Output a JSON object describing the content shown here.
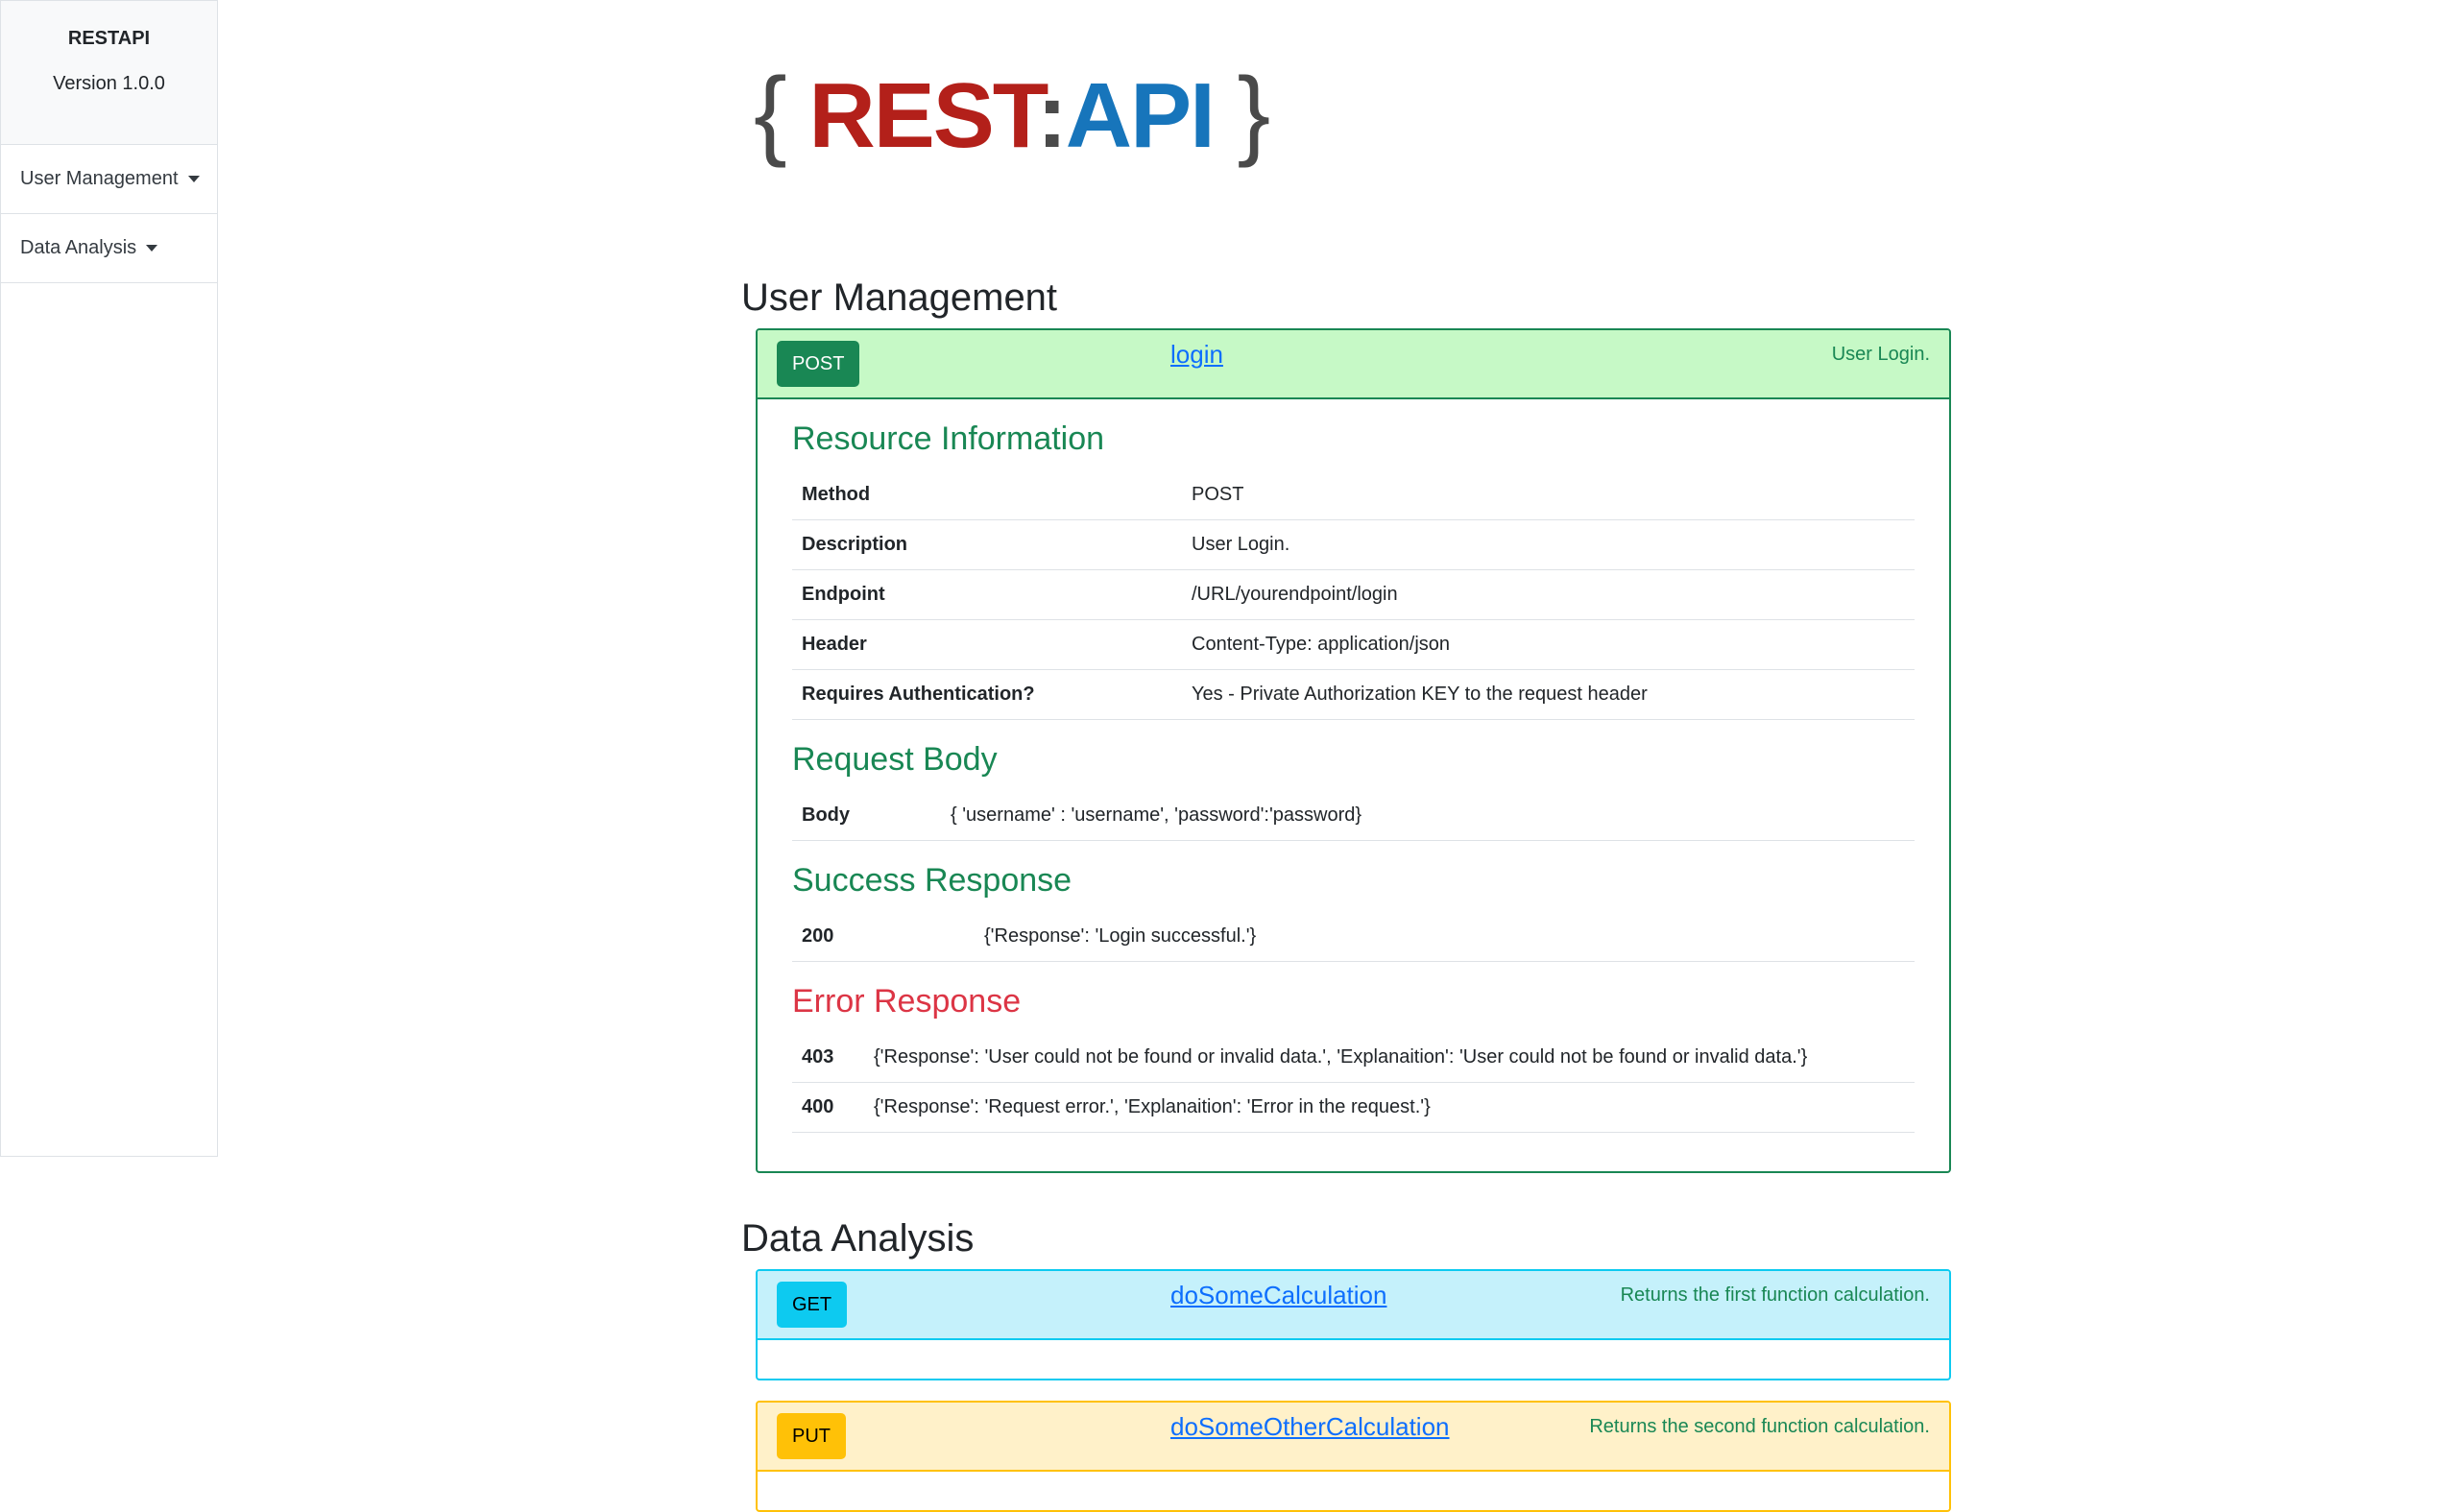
{
  "sidebar": {
    "title": "RESTAPI",
    "version": "Version 1.0.0",
    "items": [
      {
        "label": "User Management"
      },
      {
        "label": "Data Analysis"
      }
    ]
  },
  "logo": {
    "open_brace": "{",
    "rest": "REST",
    "colon": ":",
    "api": "API",
    "close_brace": "}"
  },
  "sections": {
    "user_management": {
      "title": "User Management",
      "login": {
        "method": "POST",
        "name": "login",
        "summary": "User Login.",
        "resource_title": "Resource Information",
        "resource_rows": [
          {
            "key": "Method",
            "value": "POST"
          },
          {
            "key": "Description",
            "value": "User Login."
          },
          {
            "key": "Endpoint",
            "value": "/URL/yourendpoint/login"
          },
          {
            "key": "Header",
            "value": "Content-Type: application/json"
          },
          {
            "key": "Requires Authentication?",
            "value": "Yes - Private Authorization KEY to the request header"
          }
        ],
        "request_title": "Request Body",
        "request_rows": [
          {
            "key": "Body",
            "value": "{ 'username' : 'username', 'password':'password}"
          }
        ],
        "success_title": "Success Response",
        "success_rows": [
          {
            "key": "200",
            "value": "{'Response': 'Login successful.'}"
          }
        ],
        "error_title": "Error Response",
        "error_rows": [
          {
            "key": "403",
            "value": "{'Response': 'User could not be found or invalid data.', 'Explanaition': 'User could not be found or invalid data.'}"
          },
          {
            "key": "400",
            "value": "{'Response': 'Request error.', 'Explanaition': 'Error in the request.'}"
          }
        ]
      }
    },
    "data_analysis": {
      "title": "Data Analysis",
      "endpoints": [
        {
          "method": "GET",
          "name": "doSomeCalculation",
          "summary": "Returns the first function calculation."
        },
        {
          "method": "PUT",
          "name": "doSomeOtherCalculation",
          "summary": "Returns the second function calculation."
        }
      ]
    }
  },
  "colors": {
    "post": "#198754",
    "get": "#0dcaf0",
    "put": "#ffc107",
    "error": "#dc3545",
    "link": "#0d6efd"
  }
}
